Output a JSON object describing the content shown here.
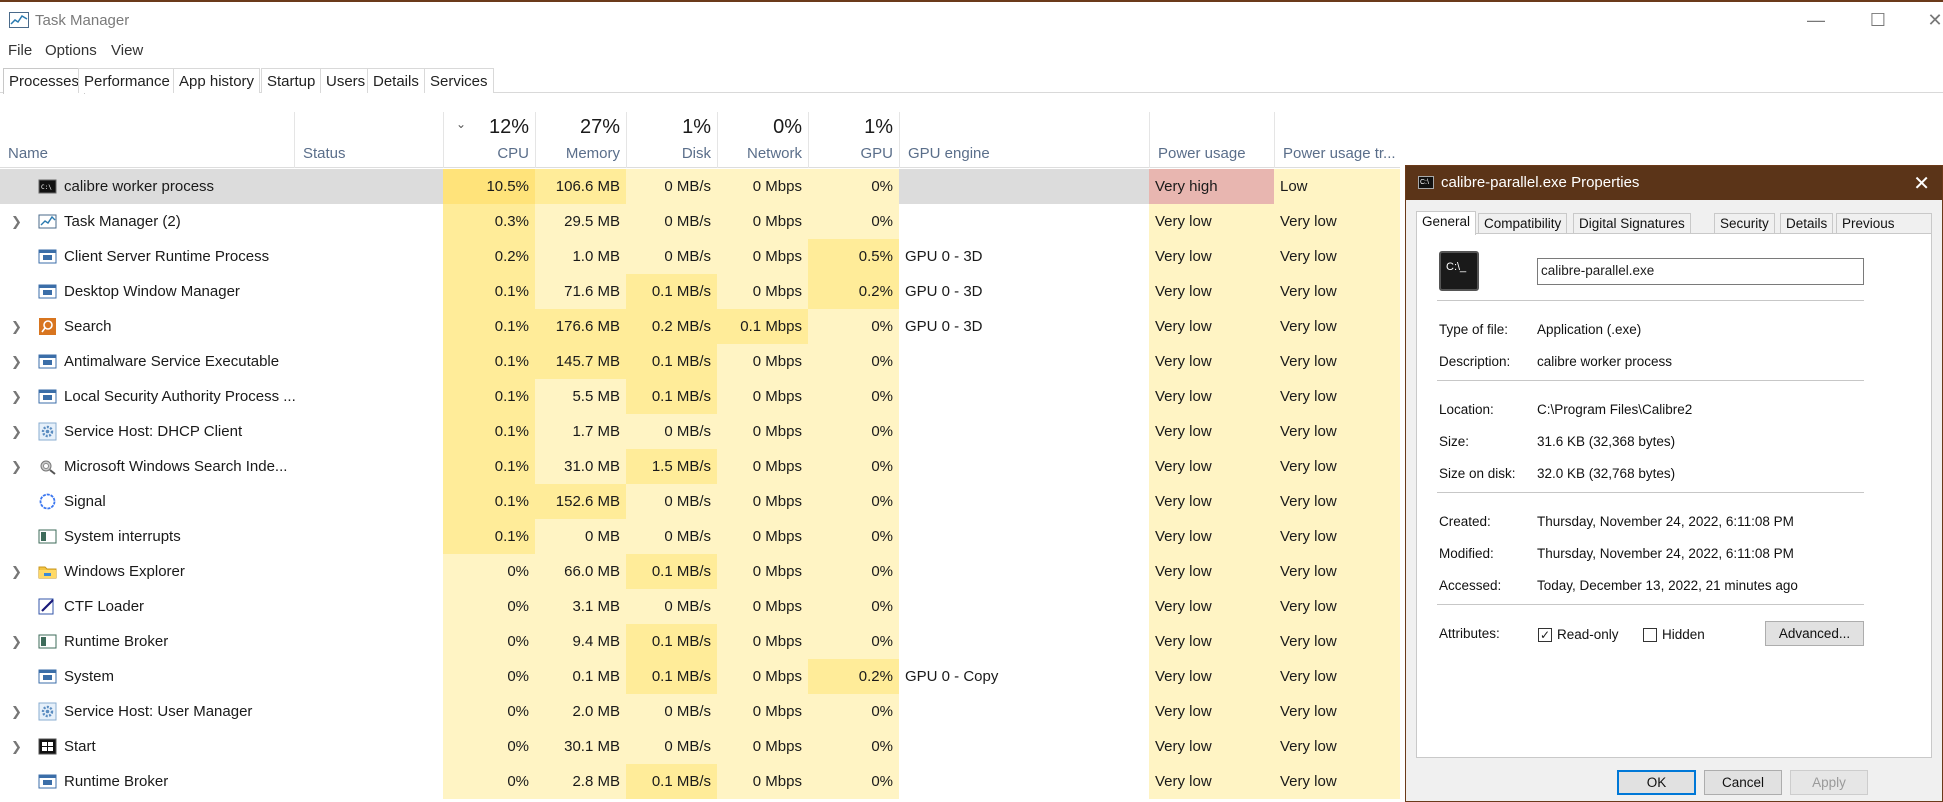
{
  "window": {
    "title": "Task Manager",
    "icon": "task-manager-icon"
  },
  "menu": [
    "File",
    "Options",
    "View"
  ],
  "tabs": [
    "Processes",
    "Performance",
    "App history",
    "Startup",
    "Users",
    "Details",
    "Services"
  ],
  "header": {
    "name": "Name",
    "status": "Status",
    "cpu_pct": "12%",
    "cpu": "CPU",
    "mem_pct": "27%",
    "mem": "Memory",
    "disk_pct": "1%",
    "disk": "Disk",
    "net_pct": "0%",
    "net": "Network",
    "gpu_pct": "1%",
    "gpu": "GPU",
    "gpu_engine": "GPU engine",
    "power": "Power usage",
    "power_trend": "Power usage tr..."
  },
  "colors": {
    "heat_light": "#fff4c4",
    "heat_medium": "#ffec99",
    "heat_strong": "#ffe37a",
    "power_very_high": "#e8b6b0",
    "selected_row": "#dcdcdc",
    "dialog_title": "#5b3418"
  },
  "processes": [
    {
      "name": "calibre worker process",
      "expand": false,
      "icon": "console-icon",
      "cpu": "10.5%",
      "mem": "106.6 MB",
      "disk": "0 MB/s",
      "net": "0 Mbps",
      "gpu": "0%",
      "engine": "",
      "power": "Very high",
      "trend": "Low"
    },
    {
      "name": "Task Manager (2)",
      "expand": true,
      "icon": "task-manager-icon",
      "cpu": "0.3%",
      "mem": "29.5 MB",
      "disk": "0 MB/s",
      "net": "0 Mbps",
      "gpu": "0%",
      "engine": "",
      "power": "Very low",
      "trend": "Very low"
    },
    {
      "name": "Client Server Runtime Process",
      "expand": false,
      "icon": "window-app-icon",
      "cpu": "0.2%",
      "mem": "1.0 MB",
      "disk": "0 MB/s",
      "net": "0 Mbps",
      "gpu": "0.5%",
      "engine": "GPU 0 - 3D",
      "power": "Very low",
      "trend": "Very low"
    },
    {
      "name": "Desktop Window Manager",
      "expand": false,
      "icon": "window-app-icon",
      "cpu": "0.1%",
      "mem": "71.6 MB",
      "disk": "0.1 MB/s",
      "net": "0 Mbps",
      "gpu": "0.2%",
      "engine": "GPU 0 - 3D",
      "power": "Very low",
      "trend": "Very low"
    },
    {
      "name": "Search",
      "expand": true,
      "icon": "search-app-icon",
      "cpu": "0.1%",
      "mem": "176.6 MB",
      "disk": "0.2 MB/s",
      "net": "0.1 Mbps",
      "gpu": "0%",
      "engine": "GPU 0 - 3D",
      "power": "Very low",
      "trend": "Very low"
    },
    {
      "name": "Antimalware Service Executable",
      "expand": true,
      "icon": "window-app-icon",
      "cpu": "0.1%",
      "mem": "145.7 MB",
      "disk": "0.1 MB/s",
      "net": "0 Mbps",
      "gpu": "0%",
      "engine": "",
      "power": "Very low",
      "trend": "Very low"
    },
    {
      "name": "Local Security Authority Process ...",
      "expand": true,
      "icon": "window-app-icon",
      "cpu": "0.1%",
      "mem": "5.5 MB",
      "disk": "0.1 MB/s",
      "net": "0 Mbps",
      "gpu": "0%",
      "engine": "",
      "power": "Very low",
      "trend": "Very low"
    },
    {
      "name": "Service Host: DHCP Client",
      "expand": true,
      "icon": "gear-icon",
      "cpu": "0.1%",
      "mem": "1.7 MB",
      "disk": "0 MB/s",
      "net": "0 Mbps",
      "gpu": "0%",
      "engine": "",
      "power": "Very low",
      "trend": "Very low"
    },
    {
      "name": "Microsoft Windows Search Inde...",
      "expand": true,
      "icon": "indexer-icon",
      "cpu": "0.1%",
      "mem": "31.0 MB",
      "disk": "1.5 MB/s",
      "net": "0 Mbps",
      "gpu": "0%",
      "engine": "",
      "power": "Very low",
      "trend": "Very low"
    },
    {
      "name": "Signal",
      "expand": false,
      "icon": "signal-icon",
      "cpu": "0.1%",
      "mem": "152.6 MB",
      "disk": "0 MB/s",
      "net": "0 Mbps",
      "gpu": "0%",
      "engine": "",
      "power": "Very low",
      "trend": "Very low"
    },
    {
      "name": "System interrupts",
      "expand": false,
      "icon": "system-icon",
      "cpu": "0.1%",
      "mem": "0 MB",
      "disk": "0 MB/s",
      "net": "0 Mbps",
      "gpu": "0%",
      "engine": "",
      "power": "Very low",
      "trend": "Very low"
    },
    {
      "name": "Windows Explorer",
      "expand": true,
      "icon": "folder-icon",
      "cpu": "0%",
      "mem": "66.0 MB",
      "disk": "0.1 MB/s",
      "net": "0 Mbps",
      "gpu": "0%",
      "engine": "",
      "power": "Very low",
      "trend": "Very low"
    },
    {
      "name": "CTF Loader",
      "expand": false,
      "icon": "pen-icon",
      "cpu": "0%",
      "mem": "3.1 MB",
      "disk": "0 MB/s",
      "net": "0 Mbps",
      "gpu": "0%",
      "engine": "",
      "power": "Very low",
      "trend": "Very low"
    },
    {
      "name": "Runtime Broker",
      "expand": true,
      "icon": "system-icon",
      "cpu": "0%",
      "mem": "9.4 MB",
      "disk": "0.1 MB/s",
      "net": "0 Mbps",
      "gpu": "0%",
      "engine": "",
      "power": "Very low",
      "trend": "Very low"
    },
    {
      "name": "System",
      "expand": false,
      "icon": "window-app-icon",
      "cpu": "0%",
      "mem": "0.1 MB",
      "disk": "0.1 MB/s",
      "net": "0 Mbps",
      "gpu": "0.2%",
      "engine": "GPU 0 - Copy",
      "power": "Very low",
      "trend": "Very low"
    },
    {
      "name": "Service Host: User Manager",
      "expand": true,
      "icon": "gear-icon",
      "cpu": "0%",
      "mem": "2.0 MB",
      "disk": "0 MB/s",
      "net": "0 Mbps",
      "gpu": "0%",
      "engine": "",
      "power": "Very low",
      "trend": "Very low"
    },
    {
      "name": "Start",
      "expand": true,
      "icon": "start-icon",
      "cpu": "0%",
      "mem": "30.1 MB",
      "disk": "0 MB/s",
      "net": "0 Mbps",
      "gpu": "0%",
      "engine": "",
      "power": "Very low",
      "trend": "Very low"
    },
    {
      "name": "Runtime Broker",
      "expand": false,
      "icon": "window-app-icon",
      "cpu": "0%",
      "mem": "2.8 MB",
      "disk": "0.1 MB/s",
      "net": "0 Mbps",
      "gpu": "0%",
      "engine": "",
      "power": "Very low",
      "trend": "Very low"
    }
  ],
  "dialog": {
    "title": "calibre-parallel.exe Properties",
    "close": "✕",
    "tabs": [
      "General",
      "Compatibility",
      "Digital Signatures",
      "Security",
      "Details",
      "Previous Versions"
    ],
    "icon_text": "C:\\_",
    "filename": "calibre-parallel.exe",
    "type_label": "Type of file:",
    "type_value": "Application (.exe)",
    "desc_label": "Description:",
    "desc_value": "calibre worker process",
    "loc_label": "Location:",
    "loc_value": "C:\\Program Files\\Calibre2",
    "size_label": "Size:",
    "size_value": "31.6 KB (32,368 bytes)",
    "sod_label": "Size on disk:",
    "sod_value": "32.0 KB (32,768 bytes)",
    "created_label": "Created:",
    "created_value": "Thursday, November 24, 2022, 6:11:08 PM",
    "modified_label": "Modified:",
    "modified_value": "Thursday, November 24, 2022, 6:11:08 PM",
    "accessed_label": "Accessed:",
    "accessed_value": "Today, December 13, 2022, 21 minutes ago",
    "attr_label": "Attributes:",
    "readonly_label": "Read-only",
    "readonly_checked": true,
    "hidden_label": "Hidden",
    "hidden_checked": false,
    "advanced": "Advanced...",
    "ok": "OK",
    "cancel": "Cancel",
    "apply": "Apply"
  }
}
